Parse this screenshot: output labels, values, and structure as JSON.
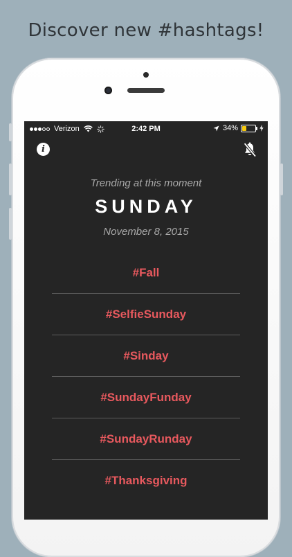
{
  "headline": "Discover new #hashtags!",
  "status_bar": {
    "carrier": "Verizon",
    "time": "2:42 PM",
    "battery_percent": "34%",
    "battery_level": 0.34,
    "icons": [
      "signal-dots-icon",
      "wifi-icon",
      "activity-spinner-icon",
      "location-arrow-icon",
      "battery-icon",
      "charging-bolt-icon"
    ]
  },
  "toolbar": {
    "info_icon": "info-icon",
    "info_glyph": "i",
    "notifications_icon": "bell-slash-icon"
  },
  "hero": {
    "subtitle": "Trending at this moment",
    "day": "SUNDAY",
    "date": "November 8, 2015"
  },
  "hashtags": [
    "#Fall",
    "#SelfieSunday",
    "#Sinday",
    "#SundayFunday",
    "#SundayRunday",
    "#Thanksgiving"
  ],
  "colors": {
    "background": "#9eb0ba",
    "screen": "#252525",
    "hashtag": "#e8595e",
    "muted_text": "#a9a9a9",
    "divider": "#5d5d5d",
    "battery_fill": "#f6c90e"
  }
}
